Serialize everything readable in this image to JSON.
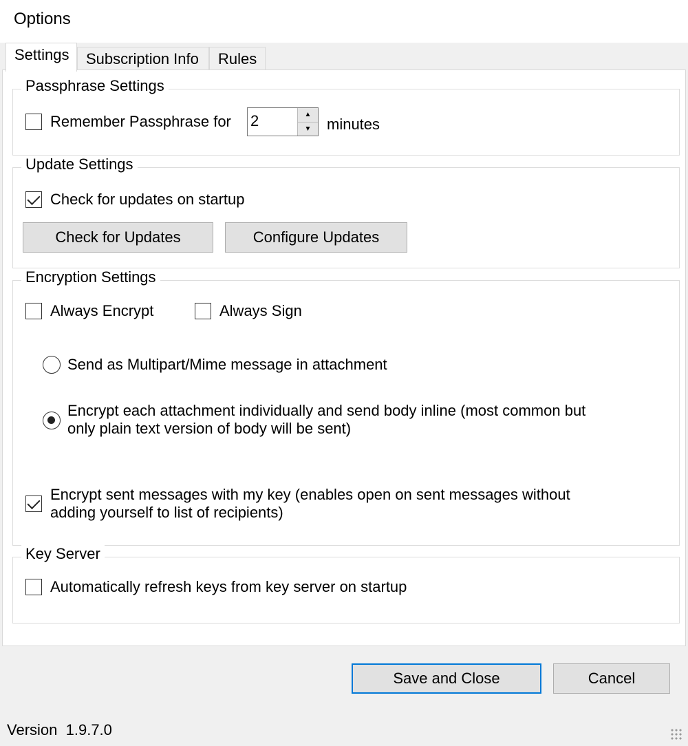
{
  "window": {
    "title": "Options"
  },
  "tabs": [
    {
      "label": "Settings",
      "active": true
    },
    {
      "label": "Subscription Info",
      "active": false
    },
    {
      "label": "Rules",
      "active": false
    }
  ],
  "passphrase": {
    "group_label": "Passphrase Settings",
    "remember_label": "Remember Passphrase for",
    "remember_checked": false,
    "minutes_value": "2",
    "minutes_unit": "minutes"
  },
  "updates": {
    "group_label": "Update Settings",
    "check_on_startup_label": "Check for updates on startup",
    "check_on_startup_checked": true,
    "check_button": "Check for Updates",
    "configure_button": "Configure Updates"
  },
  "encryption": {
    "group_label": "Encryption Settings",
    "always_encrypt_label": "Always Encrypt",
    "always_encrypt_checked": false,
    "always_sign_label": "Always Sign",
    "always_sign_checked": false,
    "radio_multipart_label": "Send as Multipart/Mime message in attachment",
    "radio_multipart_selected": false,
    "radio_inline_label_line1": "Encrypt each attachment individually and send body inline (most common but",
    "radio_inline_label_line2": "only plain text version of body will be sent)",
    "radio_inline_selected": true,
    "encrypt_sent_label_line1": "Encrypt sent messages with my key (enables open on sent messages without",
    "encrypt_sent_label_line2": "adding yourself to list of recipients)",
    "encrypt_sent_checked": true
  },
  "keyserver": {
    "group_label": "Key Server",
    "auto_refresh_label": "Automatically refresh keys from key server on startup",
    "auto_refresh_checked": false
  },
  "footer": {
    "save_button": "Save and Close",
    "cancel_button": "Cancel"
  },
  "status": {
    "version_label": "Version",
    "version_value": "1.9.7.0"
  },
  "colors": {
    "accent": "#0078d7",
    "window_bg": "#f0f0f0",
    "panel_bg": "#ffffff"
  }
}
